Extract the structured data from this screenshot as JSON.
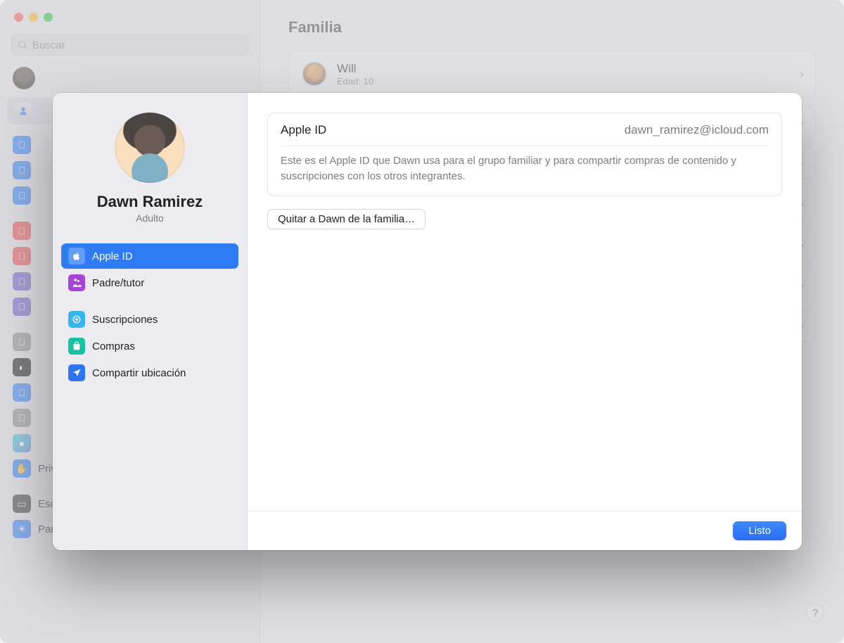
{
  "bg": {
    "search_placeholder": "Buscar",
    "title": "Familia",
    "will": {
      "name": "Will",
      "sub": "Edad: 10"
    },
    "items": [
      {
        "label": "Privacidad y seguridad"
      },
      {
        "label": "Escritorio y Dock"
      },
      {
        "label": "Pantallas"
      }
    ]
  },
  "sheet": {
    "profile": {
      "name": "Dawn Ramirez",
      "role": "Adulto"
    },
    "sidebar": {
      "items": {
        "apple_id": "Apple ID",
        "parent": "Padre/tutor",
        "subs": "Suscripciones",
        "purch": "Compras",
        "loc": "Compartir ubicación"
      }
    },
    "panel": {
      "label": "Apple ID",
      "value": "dawn_ramirez@icloud.com",
      "desc": "Este es el Apple ID que Dawn usa para el grupo familiar y para compartir compras de contenido y suscripciones con los otros integrantes."
    },
    "remove_label": "Quitar a Dawn de la familia…",
    "done_label": "Listo"
  }
}
